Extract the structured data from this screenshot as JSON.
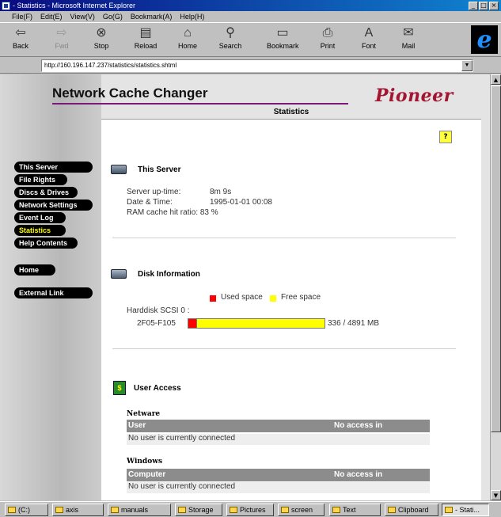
{
  "window": {
    "title": "- Statistics - Microsoft Internet Explorer"
  },
  "menu": [
    "File(F)",
    "Edit(E)",
    "View(V)",
    "Go(G)",
    "Bookmark(A)",
    "Help(H)"
  ],
  "toolbar": {
    "back": "Back",
    "forward": "Fwd",
    "stop": "Stop",
    "reload": "Reload",
    "home": "Home",
    "search": "Search",
    "bookmark": "Bookmark",
    "print": "Print",
    "font": "Font",
    "mail": "Mail"
  },
  "address": {
    "url": "http://160.196.147.237/statistics/statistics.shtml"
  },
  "header": {
    "title": "Network Cache Changer",
    "brand": "Pioneer",
    "section": "Statistics"
  },
  "nav": [
    "This Server",
    "File Rights",
    "Discs & Drives",
    "Network Settings",
    "Event Log",
    "Statistics",
    "Help Contents",
    "Home",
    "External Link"
  ],
  "server": {
    "heading": "This Server",
    "uptime_label": "Server up-time:",
    "uptime": "8m 9s",
    "datetime_label": "Date & Time:",
    "datetime": "1995-01-01 00:08",
    "cache_label": "RAM cache hit ratio:",
    "cache": "83 %"
  },
  "disk": {
    "heading": "Disk Information",
    "legend_used": "Used space",
    "legend_free": "Free space",
    "disk_label": "Harddisk SCSI 0 :",
    "partition": "2F05-F105",
    "used_mb": 336,
    "total_mb": 4891,
    "size_text": "336 / 4891 MB",
    "used_color": "#ff0000",
    "free_color": "#ffff00"
  },
  "access": {
    "heading": "User Access",
    "netware_label": "Netware",
    "netware_cols": [
      "User",
      "No access in"
    ],
    "netware_msg": "No user is currently connected",
    "windows_label": "Windows",
    "windows_cols": [
      "Computer",
      "No access in"
    ],
    "windows_msg": "No user is currently connected"
  },
  "taskbar": [
    "(C:)",
    "axis",
    "manuals",
    "Storage",
    "Pictures",
    "screen",
    "Text",
    "Clipboard",
    "- Stati..."
  ]
}
